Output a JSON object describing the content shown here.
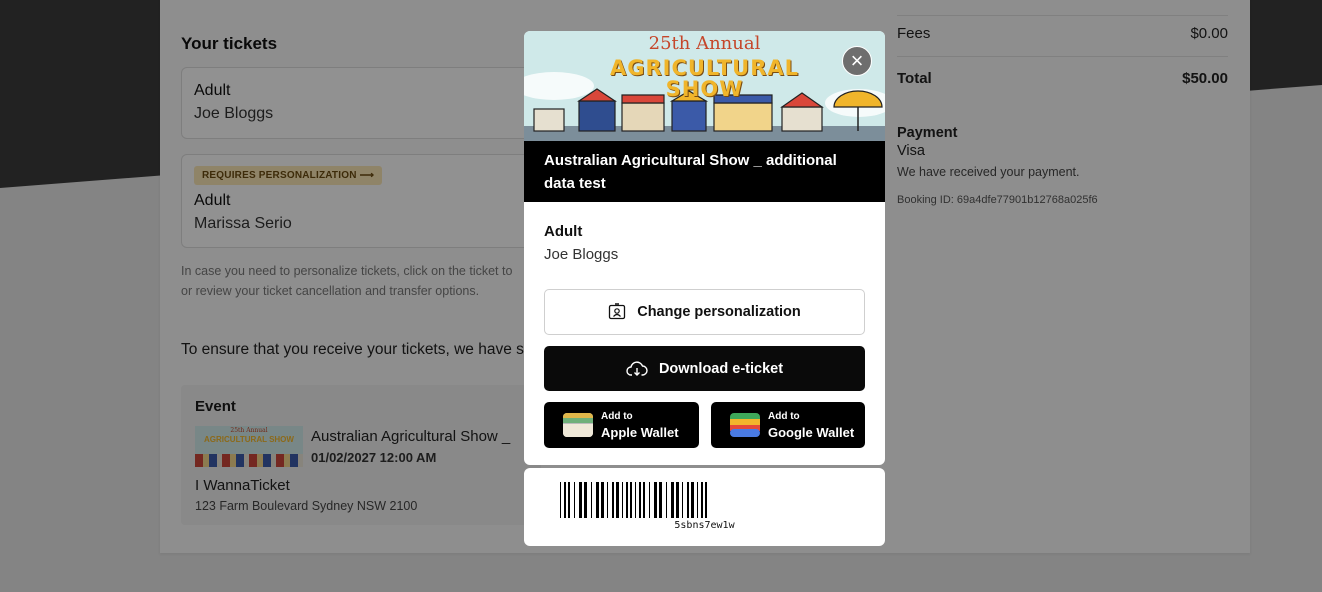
{
  "left": {
    "your_tickets_title": "Your tickets",
    "tickets": [
      {
        "type": "Adult",
        "name": "Joe Bloggs"
      },
      {
        "badge": "REQUIRES PERSONALIZATION ⟶",
        "type": "Adult",
        "name": "Marissa Serio"
      }
    ],
    "note_line1": "In case you need to personalize tickets, click on the ticket to",
    "note_line2": "or review your ticket cancellation and transfer options.",
    "ensure_text": "To ensure that you receive your tickets, we have s",
    "event": {
      "label": "Event",
      "thumb_text_1": "25th Annual",
      "thumb_text_2": "AGRICULTURAL SHOW",
      "title": "Australian Agricultural Show _",
      "datetime": "01/02/2027 12:00 AM",
      "venue": "I WannaTicket",
      "address": "123 Farm Boulevard Sydney NSW 2100"
    }
  },
  "summary": {
    "fees_label": "Fees",
    "fees_value": "$0.00",
    "total_label": "Total",
    "total_value": "$50.00",
    "payment_title": "Payment",
    "payment_method": "Visa",
    "payment_status": "We have received your payment.",
    "booking_id": "Booking ID: 69a4dfe77901b12768a025f6"
  },
  "modal": {
    "banner_line1": "25th Annual",
    "banner_line2": "AGRICULTURAL",
    "banner_line3": "SHOW",
    "close_icon": "close-icon",
    "event_title": "Australian Agricultural Show _ additional data test",
    "ticket_type": "Adult",
    "holder_name": "Joe Bloggs",
    "change_personalization": "Change personalization",
    "download_label": "Download e-ticket",
    "apple_small": "Add to",
    "apple_big": "Apple Wallet",
    "google_small": "Add to",
    "google_big": "Google Wallet",
    "barcode_value": "5sbns7ew1w",
    "colors": {
      "accent": "#000000",
      "banner_bg": "#cfe9e9",
      "banner_gold": "#f0b52b"
    }
  }
}
